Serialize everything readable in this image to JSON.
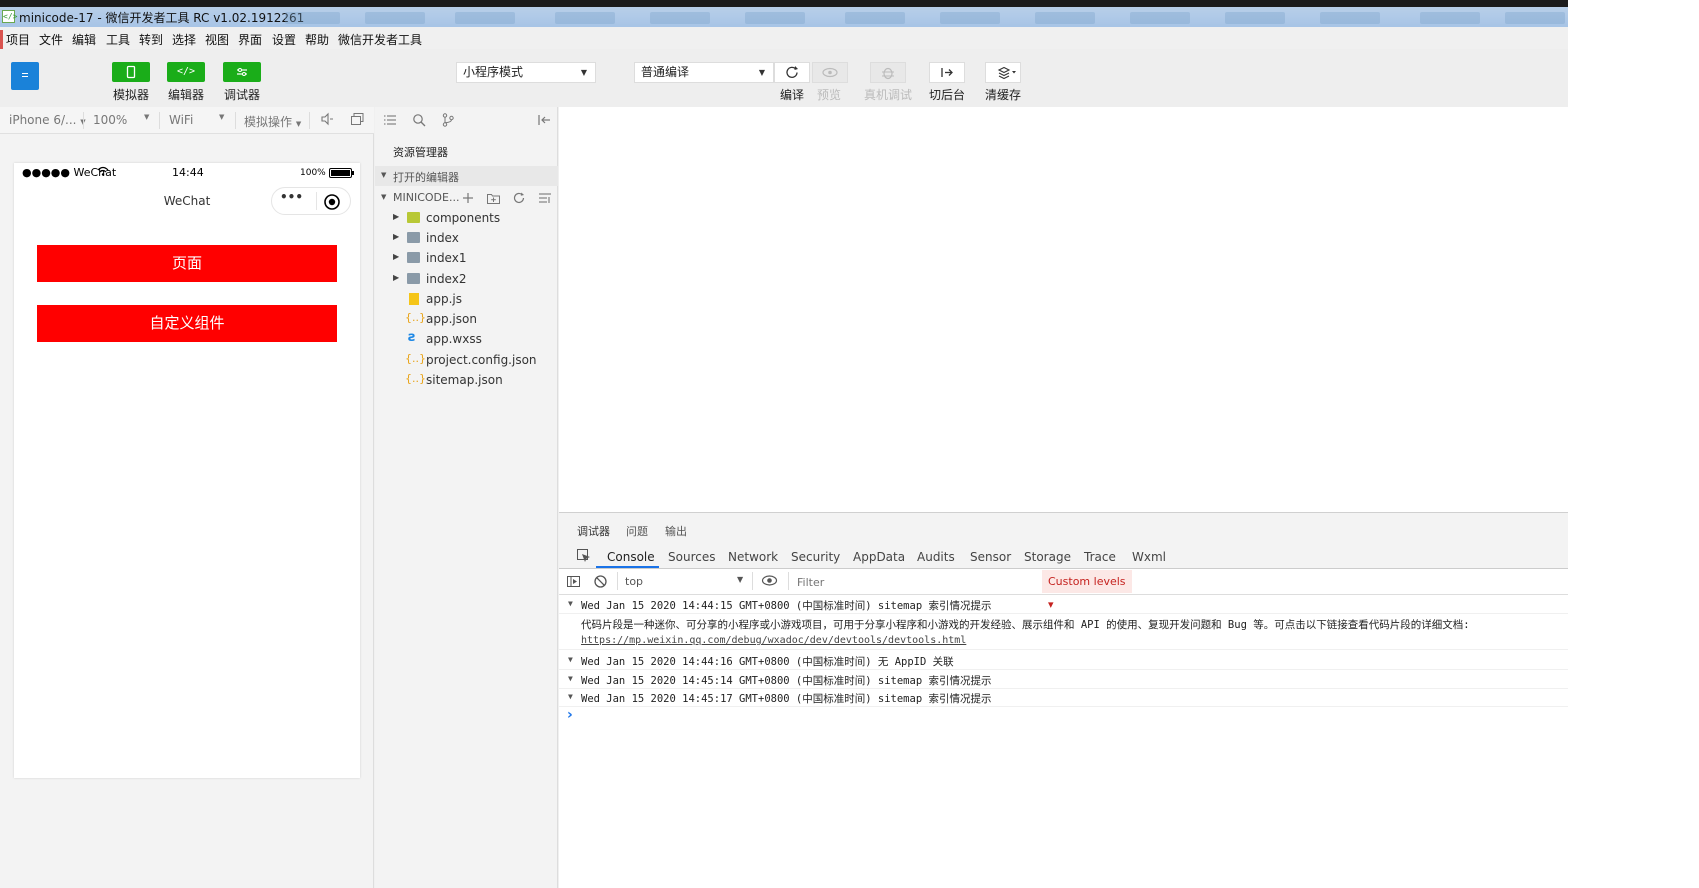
{
  "window": {
    "title": "minicode-17 - 微信开发者工具 RC v1.02.1912261"
  },
  "menu": [
    "项目",
    "文件",
    "编辑",
    "工具",
    "转到",
    "选择",
    "视图",
    "界面",
    "设置",
    "帮助",
    "微信开发者工具"
  ],
  "toolbar": {
    "simulator_label": "模拟器",
    "editor_label": "编辑器",
    "debugger_label": "调试器",
    "mode_select": "小程序模式",
    "compile_select": "普通编译",
    "compile_label": "编译",
    "preview_label": "预览",
    "remote_debug_label": "真机调试",
    "background_label": "切后台",
    "clear_cache_label": "清缓存",
    "accent_color": "#1aad19"
  },
  "simulator_bar": {
    "device": "iPhone 6/...",
    "zoom": "100%",
    "network": "WiFi",
    "operation": "模拟操作"
  },
  "phone": {
    "carrier": "●●●●● WeChat",
    "time": "14:44",
    "battery": "100%",
    "nav_title": "WeChat",
    "buttons": [
      "页面",
      "自定义组件"
    ],
    "button_color": "#ff0000"
  },
  "explorer": {
    "title": "资源管理器",
    "open_editors": "打开的编辑器",
    "project": "MINICODE...",
    "files": [
      {
        "name": "components",
        "type": "folder-special"
      },
      {
        "name": "index",
        "type": "folder"
      },
      {
        "name": "index1",
        "type": "folder"
      },
      {
        "name": "index2",
        "type": "folder"
      },
      {
        "name": "app.js",
        "type": "js"
      },
      {
        "name": "app.json",
        "type": "json"
      },
      {
        "name": "app.wxss",
        "type": "wxss"
      },
      {
        "name": "project.config.json",
        "type": "json"
      },
      {
        "name": "sitemap.json",
        "type": "json"
      }
    ]
  },
  "devtools": {
    "top_tabs": [
      "调试器",
      "问题",
      "输出"
    ],
    "tabs": [
      "Console",
      "Sources",
      "Network",
      "Security",
      "AppData",
      "Audits",
      "Sensor",
      "Storage",
      "Trace",
      "Wxml"
    ],
    "context": "top",
    "filter_placeholder": "Filter",
    "levels": "Custom levels ▾",
    "logs": [
      {
        "head": "Wed Jan 15 2020 14:44:15 GMT+0800 (中国标准时间) sitemap 索引情况提示"
      },
      {
        "detail": "代码片段是一种迷你、可分享的小程序或小游戏项目，可用于分享小程序和小游戏的开发经验、展示组件和 API 的使用、复现开发问题和 Bug 等。可点击以下链接查看代码片段的详细文档:"
      },
      {
        "link": "https://mp.weixin.qq.com/debug/wxadoc/dev/devtools/devtools.html"
      },
      {
        "head": "Wed Jan 15 2020 14:44:16 GMT+0800 (中国标准时间) 无 AppID 关联"
      },
      {
        "head": "Wed Jan 15 2020 14:45:14 GMT+0800 (中国标准时间) sitemap 索引情况提示"
      },
      {
        "head": "Wed Jan 15 2020 14:45:17 GMT+0800 (中国标准时间) sitemap 索引情况提示"
      }
    ],
    "prompt": "›"
  }
}
